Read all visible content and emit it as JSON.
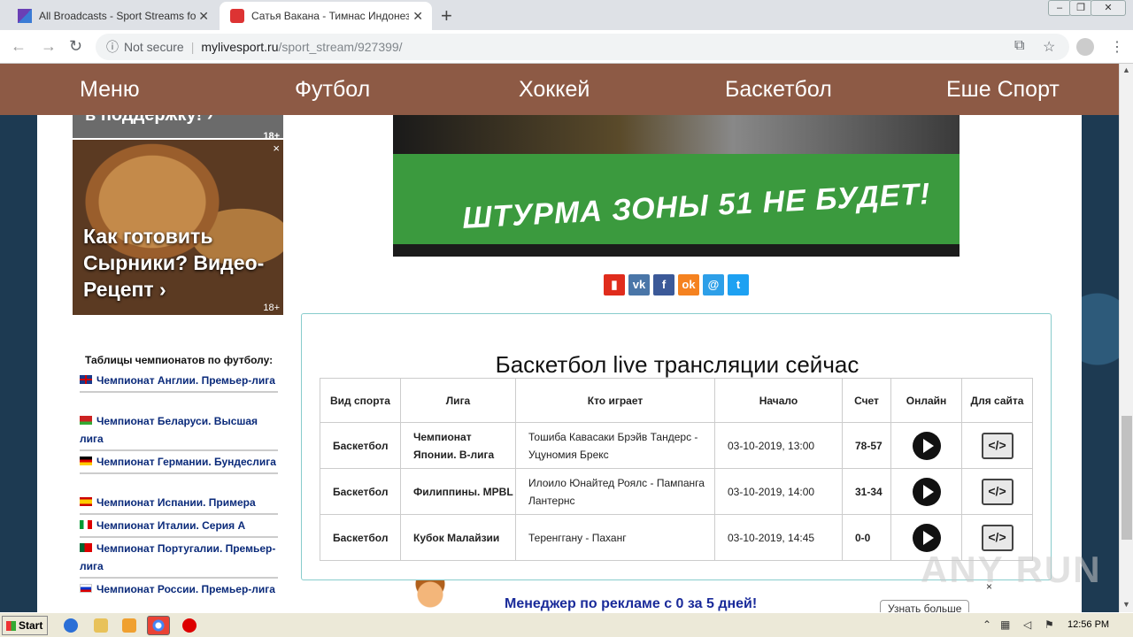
{
  "browser": {
    "tabs": [
      {
        "title": "All Broadcasts - Sport Streams for each",
        "active": false
      },
      {
        "title": "Сатья Вакана - Тимнас Индонезия",
        "active": true
      }
    ],
    "new_tab": "+",
    "url_security": "Not secure",
    "url_host": "mylivesport.ru",
    "url_path": "/sport_stream/927399/"
  },
  "nav": {
    "items": [
      "Меню",
      "Футбол",
      "Хоккей",
      "Баскетбол",
      "Еше Спорт"
    ]
  },
  "ads": {
    "top_text": "в поддержку! ›",
    "age": "18+",
    "food_text": "Как готовить Сырники? Видео-Рецепт ›",
    "banner_text": "ШТУРМА ЗОНЫ 51 НЕ БУДЕТ!",
    "bottom_text": "Менеджер по рекламе с 0 за 5 дней!",
    "bottom_more": "Узнать больше",
    "close": "×"
  },
  "leagues": {
    "heading": "Таблицы чемпионатов по футболу:",
    "items": [
      {
        "label": "Чемпионат Англии. Премьер-лига",
        "flag": "gb"
      },
      {
        "label": "Чемпионат Беларуси. Высшая лига",
        "flag": "by"
      },
      {
        "label": "Чемпионат Германии. Бундеслига",
        "flag": "de"
      },
      {
        "label": "Чемпионат Испании. Примера",
        "flag": "es"
      },
      {
        "label": "Чемпионат Италии. Серия А",
        "flag": "it"
      },
      {
        "label": "Чемпионат Португалии. Премьер-лига",
        "flag": "pt"
      },
      {
        "label": "Чемпионат России. Премьер-лига",
        "flag": "ru"
      }
    ]
  },
  "share": [
    "bookmark",
    "vk",
    "facebook",
    "odnoklassniki",
    "moimir",
    "twitter"
  ],
  "broadcasts": {
    "title": "Баскетбол live трансляции сейчас",
    "headers": [
      "Вид спорта",
      "Лига",
      "Кто играет",
      "Начало",
      "Счет",
      "Онлайн",
      "Для сайта"
    ],
    "rows": [
      {
        "sport": "Баскетбол",
        "league": "Чемпионат Японии. B-лига",
        "teams": "Тошиба Кавасаки Брэйв Тандерс - Уцуномия Брекс",
        "start": "03-10-2019, 13:00",
        "score": "78-57"
      },
      {
        "sport": "Баскетбол",
        "league": "Филиппины. MPBL",
        "teams": "Илоило Юнайтед Роялс - Пампанга Лантернс",
        "start": "03-10-2019, 14:00",
        "score": "31-34"
      },
      {
        "sport": "Баскетбол",
        "league": "Кубок Малайзии",
        "teams": "Теренггану - Паханг",
        "start": "03-10-2019, 14:45",
        "score": "0-0"
      }
    ],
    "embed_glyph": "</>"
  },
  "watermark": "ANY RUN",
  "taskbar": {
    "start": "Start",
    "clock": "12:56 PM"
  }
}
